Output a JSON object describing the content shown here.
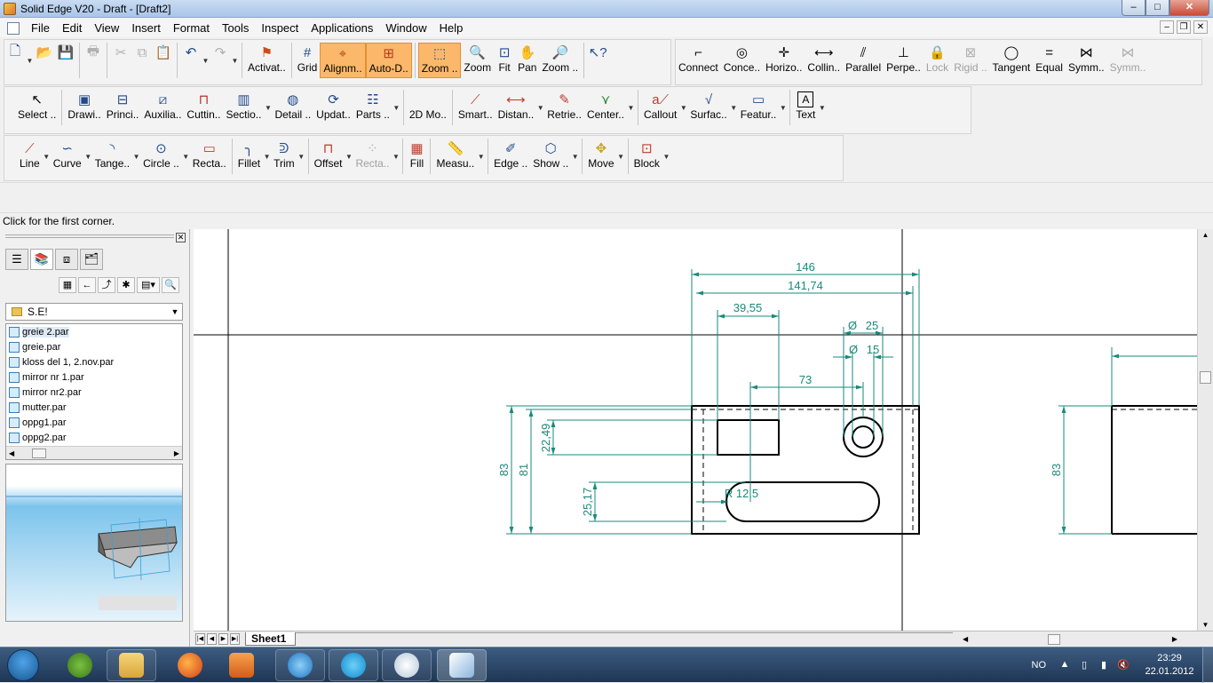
{
  "window": {
    "title": "Solid Edge V20 - Draft - [Draft2]",
    "min": "–",
    "max": "□",
    "close": "✕"
  },
  "menu": [
    "File",
    "Edit",
    "View",
    "Insert",
    "Format",
    "Tools",
    "Inspect",
    "Applications",
    "Window",
    "Help"
  ],
  "toolbar1": {
    "activate": "Activat..",
    "grid": "Grid",
    "alignment": "Alignm..",
    "autodim": "Auto-D..",
    "zoom_area": "Zoom ..",
    "zoom": "Zoom",
    "fit": "Fit",
    "pan": "Pan",
    "zoom_prev": "Zoom .."
  },
  "toolbar_rel": {
    "connect": "Connect",
    "concentric": "Conce..",
    "horizontal": "Horizo..",
    "collinear": "Collin..",
    "parallel": "Parallel",
    "perpendicular": "Perpe..",
    "lock": "Lock",
    "rigid": "Rigid ..",
    "tangent": "Tangent",
    "equal": "Equal",
    "symmetric": "Symm..",
    "symmetric2": "Symm.."
  },
  "toolbar2": {
    "select": "Select ..",
    "drawing": "Drawi..",
    "principal": "Princi..",
    "auxiliary": "Auxilia..",
    "cutting": "Cuttin..",
    "section": "Sectio..",
    "detail": "Detail ..",
    "update": "Updat..",
    "parts": "Parts ..",
    "model2d": "2D Mo..",
    "smart": "Smart..",
    "distance": "Distan..",
    "retrieve": "Retrie..",
    "center": "Center..",
    "callout": "Callout",
    "surface": "Surfac..",
    "feature": "Featur..",
    "text": "Text"
  },
  "toolbar3": {
    "line": "Line",
    "curve": "Curve",
    "tangent_arc": "Tange..",
    "circle": "Circle ..",
    "rectangle": "Recta..",
    "fillet": "Fillet",
    "trim": "Trim",
    "offset": "Offset",
    "rectangle2": "Recta..",
    "fill": "Fill",
    "measure": "Measu..",
    "edge": "Edge ..",
    "show": "Show ..",
    "move": "Move",
    "block": "Block"
  },
  "status": "Click for the first corner.",
  "library": {
    "folder": "S.E!",
    "files": [
      "greie 2.par",
      "greie.par",
      "kloss del 1, 2.nov.par",
      "mirror nr 1.par",
      "mirror nr2.par",
      "mutter.par",
      "oppg1.par",
      "oppg2.par"
    ]
  },
  "drawing": {
    "dim_146": "146",
    "dim_14174": "141,74",
    "dim_3955": "39,55",
    "dim_d25": "25",
    "dim_d15": "15",
    "dim_73": "73",
    "dim_2249": "22,49",
    "dim_83": "83",
    "dim_81": "81",
    "dim_2517": "25,17",
    "dim_r": "R 12,5",
    "dim_83_right": "83",
    "diameter_symbol": "Ø"
  },
  "sheet_tab": "Sheet1",
  "tray": {
    "lang": "NO",
    "time": "23:29",
    "date": "22.01.2012"
  },
  "colors": {
    "dimension": "#1a8a7c",
    "highlight": "#fbb86a"
  }
}
